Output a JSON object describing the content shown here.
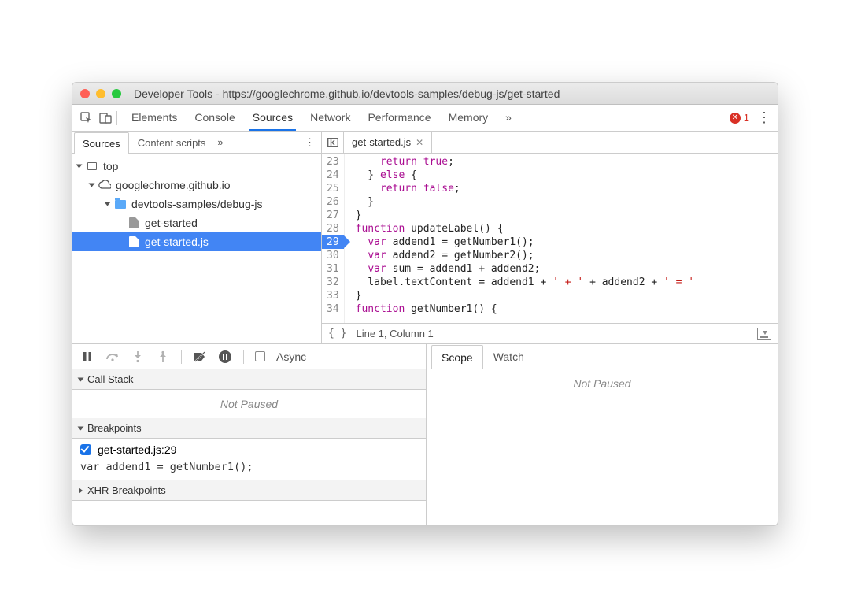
{
  "window": {
    "title": "Developer Tools - https://googlechrome.github.io/devtools-samples/debug-js/get-started"
  },
  "toolbar": {
    "panels": [
      "Elements",
      "Console",
      "Sources",
      "Network",
      "Performance",
      "Memory"
    ],
    "overflow": "»",
    "active_panel": "Sources",
    "error_count": "1"
  },
  "sources_sidebar": {
    "tabs": [
      "Sources",
      "Content scripts"
    ],
    "overflow": "»",
    "active": "Sources",
    "tree": {
      "top": "top",
      "origin": "googlechrome.github.io",
      "folder": "devtools-samples/debug-js",
      "files": [
        "get-started",
        "get-started.js"
      ],
      "selected": "get-started.js"
    }
  },
  "open_file": {
    "name": "get-started.js",
    "status": "Line 1, Column 1",
    "lines": [
      {
        "n": "23",
        "t": "    return true;"
      },
      {
        "n": "24",
        "t": "  } else {"
      },
      {
        "n": "25",
        "t": "    return false;"
      },
      {
        "n": "26",
        "t": "  }"
      },
      {
        "n": "27",
        "t": "}"
      },
      {
        "n": "28",
        "t": "function updateLabel() {"
      },
      {
        "n": "29",
        "t": "  var addend1 = getNumber1();",
        "bp": true
      },
      {
        "n": "30",
        "t": "  var addend2 = getNumber2();"
      },
      {
        "n": "31",
        "t": "  var sum = addend1 + addend2;"
      },
      {
        "n": "32",
        "t": "  label.textContent = addend1 + ' + ' + addend2 + ' = '"
      },
      {
        "n": "33",
        "t": "}"
      },
      {
        "n": "34",
        "t": "function getNumber1() {"
      }
    ]
  },
  "debugger": {
    "async_label": "Async",
    "call_stack": {
      "title": "Call Stack",
      "status": "Not Paused"
    },
    "breakpoints": {
      "title": "Breakpoints",
      "items": [
        {
          "label": "get-started.js:29",
          "code": "var addend1 = getNumber1();",
          "enabled": true
        }
      ]
    },
    "xhr": {
      "title": "XHR Breakpoints"
    },
    "scope": {
      "tabs": [
        "Scope",
        "Watch"
      ],
      "active": "Scope",
      "status": "Not Paused"
    }
  }
}
